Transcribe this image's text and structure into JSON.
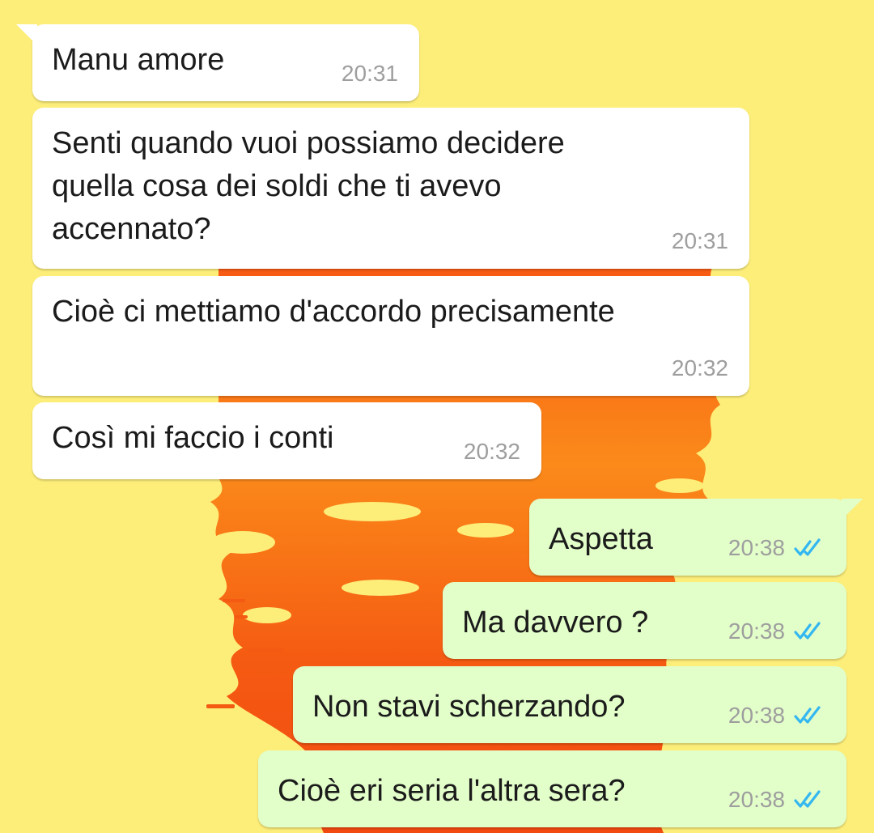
{
  "colors": {
    "wallpaper": "#fdee7a",
    "incoming_bubble": "#ffffff",
    "outgoing_bubble": "#e2fec9",
    "time_text": "#9e9e9e",
    "read_ticks": "#34b7f1",
    "wallpaper_flame": "#f45a12",
    "wallpaper_flame_light": "#fb9a1c"
  },
  "messages": [
    {
      "direction": "incoming",
      "text": "Manu amore",
      "time": "20:31"
    },
    {
      "direction": "incoming",
      "text": "Senti quando vuoi possiamo decidere\nquella cosa dei soldi che ti avevo\naccennato?",
      "time": "20:31"
    },
    {
      "direction": "incoming",
      "text": "Cioè ci mettiamo d'accordo precisamente",
      "time": "20:32"
    },
    {
      "direction": "incoming",
      "text": "Così mi faccio i conti",
      "time": "20:32"
    },
    {
      "direction": "outgoing",
      "text": "Aspetta",
      "time": "20:38",
      "status": "read",
      "status_icon": "double-check-icon"
    },
    {
      "direction": "outgoing",
      "text": "Ma davvero ?",
      "time": "20:38",
      "status": "read",
      "status_icon": "double-check-icon"
    },
    {
      "direction": "outgoing",
      "text": "Non stavi scherzando?",
      "time": "20:38",
      "status": "read",
      "status_icon": "double-check-icon"
    },
    {
      "direction": "outgoing",
      "text": "Cioè eri seria l'altra sera?",
      "time": "20:38",
      "status": "read",
      "status_icon": "double-check-icon"
    }
  ]
}
